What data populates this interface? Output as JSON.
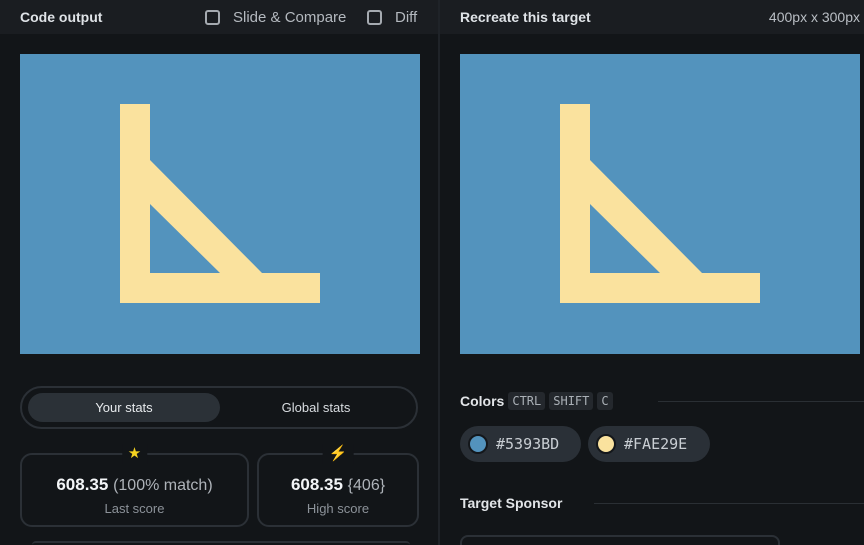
{
  "left_panel": {
    "title": "Code output",
    "slide_compare_label": "Slide & Compare",
    "diff_label": "Diff",
    "toggle": {
      "your_stats": "Your stats",
      "global_stats": "Global stats"
    },
    "last_score": {
      "value": "608.35",
      "detail": "(100% match)",
      "label": "Last score"
    },
    "high_score": {
      "value": "608.35",
      "detail": "{406}",
      "label": "High score"
    }
  },
  "right_panel": {
    "title": "Recreate this target",
    "size": "400px x 300px",
    "colors_title": "Colors",
    "shortcut": [
      "CTRL",
      "SHIFT",
      "C"
    ],
    "colors": [
      {
        "label": "#5393BD",
        "hex": "#5393BD"
      },
      {
        "label": "#FAE29E",
        "hex": "#FAE29E"
      }
    ],
    "sponsor_title": "Target Sponsor"
  },
  "palette": {
    "background": "#5393BD",
    "shape": "#FAE29E"
  }
}
